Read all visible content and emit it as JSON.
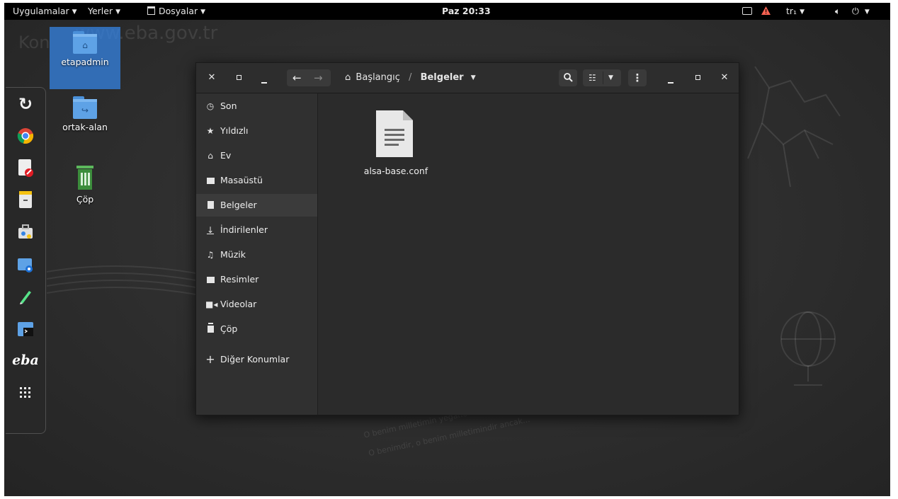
{
  "topbar": {
    "apps_label": "Uygulamalar",
    "places_label": "Yerler",
    "files_label": "Dosyalar",
    "clock": "Paz 20:33",
    "keyboard_layout": "tr₁"
  },
  "wallpaper": {
    "url_text": "www.eba.gov.tr",
    "partial_text": "Kon",
    "phrase_line1": "O benim milletimin yegane...",
    "phrase_line2": "O benimdir, o benim milletimindir ancak..."
  },
  "desktop": {
    "icons": [
      {
        "label": "etapadmin",
        "icon": "home-folder-icon"
      },
      {
        "label": "ortak-alan",
        "icon": "shared-folder-icon"
      },
      {
        "label": "Çöp",
        "icon": "trash-icon"
      }
    ]
  },
  "dock": {
    "apps": [
      "refresh-icon",
      "chrome-icon",
      "document-editor-icon",
      "file-cabinet-icon",
      "briefcase-icon",
      "screenshot-icon",
      "pencil-icon",
      "terminal-icon",
      "eba-icon",
      "app-grid-icon"
    ],
    "eba_text": "eba"
  },
  "window": {
    "breadcrumb_home": "Başlangıç",
    "breadcrumb_separator": "/",
    "breadcrumb_current": "Belgeler",
    "sidebar": [
      {
        "label": "Son",
        "icon": "clock-icon"
      },
      {
        "label": "Yıldızlı",
        "icon": "star-icon"
      },
      {
        "label": "Ev",
        "icon": "home-icon"
      },
      {
        "label": "Masaüstü",
        "icon": "desktop-icon"
      },
      {
        "label": "Belgeler",
        "icon": "documents-icon",
        "active": true
      },
      {
        "label": "İndirilenler",
        "icon": "download-icon"
      },
      {
        "label": "Müzik",
        "icon": "music-icon"
      },
      {
        "label": "Resimler",
        "icon": "pictures-icon"
      },
      {
        "label": "Videolar",
        "icon": "video-icon"
      },
      {
        "label": "Çöp",
        "icon": "trash-icon"
      },
      {
        "label": "Diğer Konumlar",
        "icon": "plus-icon"
      }
    ],
    "files": [
      {
        "name": "alsa-base.conf",
        "icon": "text-file-icon"
      }
    ]
  },
  "colors": {
    "topbar_bg": "#000000",
    "selection": "#3584e4",
    "folder": "#5ea2e6",
    "warning": "#e01b24"
  }
}
